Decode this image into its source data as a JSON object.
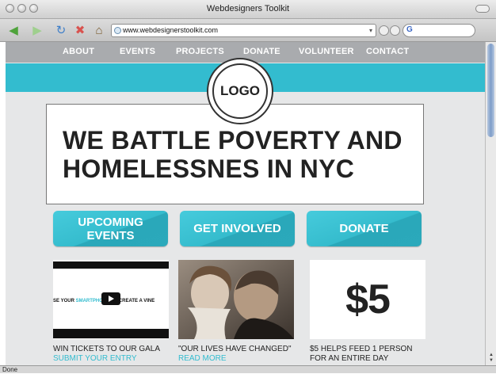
{
  "window": {
    "title": "Webdesigners Toolkit"
  },
  "toolbar": {
    "url": "www.webdesignerstoolkit.com",
    "search_placeholder": ""
  },
  "nav": {
    "items": [
      "ABOUT",
      "EVENTS",
      "PROJECTS",
      "DONATE",
      "VOLUNTEER",
      "CONTACT"
    ]
  },
  "logo": {
    "text": "LOGO"
  },
  "hero": {
    "headline": "WE BATTLE POVERTY AND HOMELESSNES IN NYC"
  },
  "cta": [
    "UPCOMING EVENTS",
    "GET INVOLVED",
    "DONATE"
  ],
  "cards": [
    {
      "video_text_pre": "SE YOUR ",
      "video_text_blue": "SMARTPHONE",
      "video_text_post": " TO CREATE A VINE",
      "caption": "WIN TICKETS TO OUR GALA",
      "link": "SUBMIT YOUR ENTRY"
    },
    {
      "caption": "\"OUR LIVES HAVE CHANGED\"",
      "link": "READ MORE"
    },
    {
      "big_text": "$5",
      "caption": "$5 HELPS FEED 1 PERSON FOR AN ENTIRE DAY"
    }
  ],
  "status": {
    "text": "Done"
  },
  "colors": {
    "accent": "#33bccf",
    "nav": "#a9abae",
    "page_bg": "#e6e7e8"
  }
}
